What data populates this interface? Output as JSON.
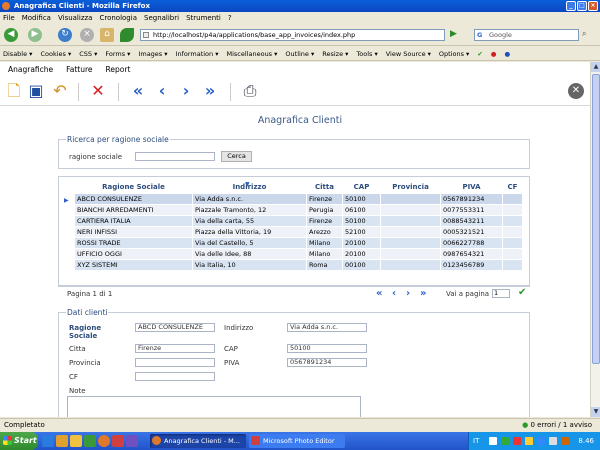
{
  "window": {
    "title": "Anagrafica Clienti - Mozilla Firefox"
  },
  "browser_menu": [
    "File",
    "Modifica",
    "Visualizza",
    "Cronologia",
    "Segnalibri",
    "Strumenti",
    "?"
  ],
  "address": {
    "url": "http://localhost/p4a/applications/base_app_invoices/index.php"
  },
  "search": {
    "placeholder": "Google"
  },
  "webdev_toolbar": [
    {
      "label": "Disable ▾"
    },
    {
      "label": "Cookies ▾"
    },
    {
      "label": "CSS ▾"
    },
    {
      "label": "Forms ▾"
    },
    {
      "label": "Images ▾"
    },
    {
      "label": "Information ▾"
    },
    {
      "label": "Miscellaneous ▾"
    },
    {
      "label": "Outline ▾"
    },
    {
      "label": "Resize ▾"
    },
    {
      "label": "Tools ▾"
    },
    {
      "label": "View Source ▾"
    },
    {
      "label": "Options ▾"
    }
  ],
  "app_menu": [
    "Anagrafiche",
    "Fatture",
    "Report"
  ],
  "page": {
    "heading": "Anagrafica Clienti"
  },
  "search_panel": {
    "legend": "Ricerca per ragione sociale",
    "label": "ragione sociale",
    "value": "",
    "button": "Cerca"
  },
  "table": {
    "columns": [
      "Ragione Sociale",
      "Indirizzo",
      "Citta",
      "CAP",
      "Provincia",
      "PIVA",
      "CF"
    ],
    "rows": [
      [
        "ABCD CONSULENZE",
        "Via Adda s.n.c.",
        "Firenze",
        "50100",
        "",
        "0567891234",
        ""
      ],
      [
        "BIANCHI ARREDAMENTI",
        "Piazzale Tramonto, 12",
        "Perugia",
        "06100",
        "",
        "0077553311",
        ""
      ],
      [
        "CARTIERA ITALIA",
        "Via della carta, 55",
        "Firenze",
        "50100",
        "",
        "0088543211",
        ""
      ],
      [
        "NERI INFISSI",
        "Piazza della Vittoria, 19",
        "Arezzo",
        "52100",
        "",
        "0005321521",
        ""
      ],
      [
        "ROSSI TRADE",
        "Via del Castello, 5",
        "Milano",
        "20100",
        "",
        "0066227788",
        ""
      ],
      [
        "UFFICIO OGGI",
        "Via delle Idee, 88",
        "Milano",
        "20100",
        "",
        "0987654321",
        ""
      ],
      [
        "XYZ SISTEMI",
        "Via Italia, 10",
        "Roma",
        "00100",
        "",
        "0123456789",
        ""
      ]
    ]
  },
  "pager": {
    "label": "Pagina 1 di 1",
    "goto_label": "Vai a pagina",
    "goto_value": "1"
  },
  "detail": {
    "legend": "Dati clienti",
    "ragione_sociale_label": "Ragione Sociale",
    "ragione_sociale": "ABCD CONSULENZE",
    "indirizzo_label": "Indirizzo",
    "indirizzo": "Via Adda s.n.c.",
    "citta_label": "Citta",
    "citta": "Firenze",
    "cap_label": "CAP",
    "cap": "50100",
    "provincia_label": "Provincia",
    "provincia": "",
    "piva_label": "PIVA",
    "piva": "0567891234",
    "cf_label": "CF",
    "cf": "",
    "note_label": "Note"
  },
  "status": {
    "left": "Completato",
    "right": "0 errori / 1 avviso"
  },
  "taskbar": {
    "start": "Start",
    "tasks": [
      "Anagrafica Clienti - M...",
      "Microsoft Photo Editor"
    ],
    "clock": "8.46",
    "lang": "IT"
  }
}
